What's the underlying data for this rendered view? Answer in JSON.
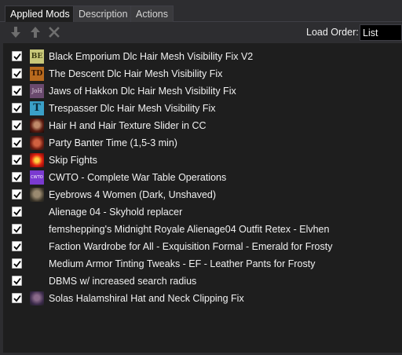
{
  "tabs": [
    {
      "label": "Applied Mods",
      "active": true
    },
    {
      "label": "Description",
      "active": false
    },
    {
      "label": "Actions",
      "active": false
    }
  ],
  "toolbar": {
    "move_down_icon": "arrow-down-icon",
    "move_up_icon": "arrow-up-icon",
    "remove_icon": "close-icon",
    "load_order_label": "Load Order:",
    "load_order_value": "List"
  },
  "mods": [
    {
      "name": "Black Emporium Dlc Hair Mesh Visibility Fix V2",
      "checked": true,
      "thumb": "BE"
    },
    {
      "name": "The Descent Dlc Hair Mesh Visibility Fix",
      "checked": true,
      "thumb": "TD"
    },
    {
      "name": "Jaws of Hakkon Dlc Hair Mesh Visibility Fix",
      "checked": true,
      "thumb": "JoH"
    },
    {
      "name": "Trespasser Dlc Hair Mesh Visibility Fix",
      "checked": true,
      "thumb": "T"
    },
    {
      "name": "Hair H and Hair Texture Slider in CC",
      "checked": true,
      "thumb": ""
    },
    {
      "name": "Party Banter Time (1,5-3 min)",
      "checked": true,
      "thumb": ""
    },
    {
      "name": "Skip Fights",
      "checked": true,
      "thumb": ""
    },
    {
      "name": "CWTO - Complete War Table Operations",
      "checked": true,
      "thumb": "CWTO"
    },
    {
      "name": "Eyebrows 4 Women (Dark, Unshaved)",
      "checked": true,
      "thumb": ""
    },
    {
      "name": "Alienage 04 - Skyhold replacer",
      "checked": true,
      "thumb": ""
    },
    {
      "name": "femshepping's Midnight Royale Alienage04 Outfit Retex - Elvhen",
      "checked": true,
      "thumb": ""
    },
    {
      "name": "Faction Wardrobe for All - Exquisition Formal - Emerald for Frosty",
      "checked": true,
      "thumb": ""
    },
    {
      "name": "Medium Armor Tinting Tweaks - EF - Leather Pants for Frosty",
      "checked": true,
      "thumb": ""
    },
    {
      "name": "DBMS w/ increased search radius",
      "checked": true,
      "thumb": ""
    },
    {
      "name": "Solas Halamshiral Hat and Neck Clipping Fix",
      "checked": true,
      "thumb": ""
    }
  ]
}
